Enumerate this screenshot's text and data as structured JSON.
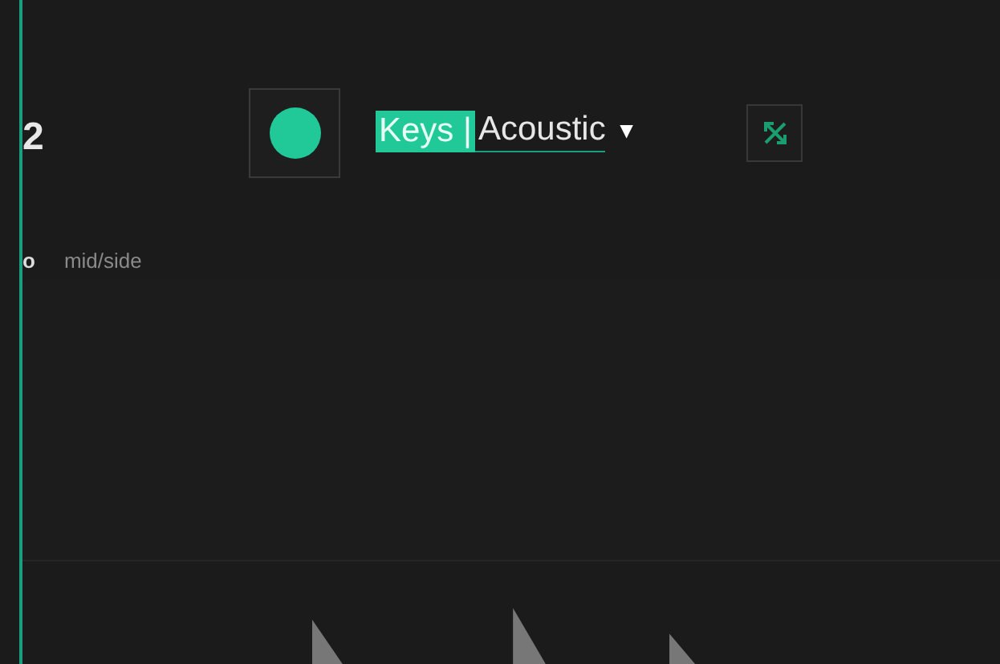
{
  "track": {
    "number": "2",
    "record_armed": true,
    "name_parts": [
      {
        "text": "Keys |",
        "selected": true
      },
      {
        "text": "Acoustic",
        "selected": false
      }
    ],
    "dropdown_caret": "▼"
  },
  "stereo": {
    "mode_letter": "o",
    "mode": "mid/side"
  }
}
